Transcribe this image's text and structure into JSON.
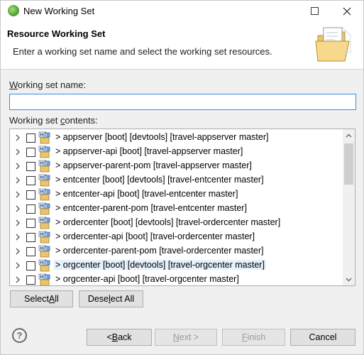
{
  "window": {
    "title": "New Working Set"
  },
  "header": {
    "title": "Resource Working Set",
    "message": "Enter a working set name and select the working set resources."
  },
  "name_field": {
    "label": "Working set name:",
    "mnemonic": "W",
    "value": ""
  },
  "contents": {
    "label_before": "Working set ",
    "label_mnemonic": "c",
    "label_after": "ontents:",
    "items": [
      {
        "label": "> appserver [boot] [devtools] [travel-appserver master]",
        "checked": false,
        "highlighted": false
      },
      {
        "label": "> appserver-api [boot] [travel-appserver master]",
        "checked": false,
        "highlighted": false
      },
      {
        "label": "> appserver-parent-pom [travel-appserver master]",
        "checked": false,
        "highlighted": false
      },
      {
        "label": "> entcenter [boot] [devtools] [travel-entcenter master]",
        "checked": false,
        "highlighted": false
      },
      {
        "label": "> entcenter-api [boot] [travel-entcenter master]",
        "checked": false,
        "highlighted": false
      },
      {
        "label": "> entcenter-parent-pom [travel-entcenter master]",
        "checked": false,
        "highlighted": false
      },
      {
        "label": "> ordercenter [boot] [devtools] [travel-ordercenter master]",
        "checked": false,
        "highlighted": false
      },
      {
        "label": "> ordercenter-api [boot] [travel-ordercenter master]",
        "checked": false,
        "highlighted": false
      },
      {
        "label": "> ordercenter-parent-pom [travel-ordercenter master]",
        "checked": false,
        "highlighted": false
      },
      {
        "label": "> orgcenter [boot] [devtools] [travel-orgcenter master]",
        "checked": false,
        "highlighted": true
      },
      {
        "label": "> orgcenter-api [boot] [travel-orgcenter master]",
        "checked": false,
        "highlighted": false
      }
    ]
  },
  "buttons": {
    "select_all": {
      "before": "Select ",
      "mnemonic": "A",
      "after": "ll"
    },
    "deselect_all": {
      "before": "Dese",
      "mnemonic": "l",
      "after": "ect All"
    },
    "back": {
      "before": "< ",
      "mnemonic": "B",
      "after": "ack"
    },
    "next": {
      "before": "",
      "mnemonic": "N",
      "after": "ext >"
    },
    "finish": {
      "before": "",
      "mnemonic": "F",
      "after": "inish"
    },
    "cancel": {
      "label": "Cancel"
    }
  },
  "icons": {
    "app": "eclipse-spring-icon",
    "folder": "folder-icon",
    "help": "help-icon",
    "project": "maven-project-icon"
  },
  "colors": {
    "accent": "#3b8fd6",
    "highlight": "#e5f1fb",
    "dialog_bg": "#f0f0f0"
  }
}
